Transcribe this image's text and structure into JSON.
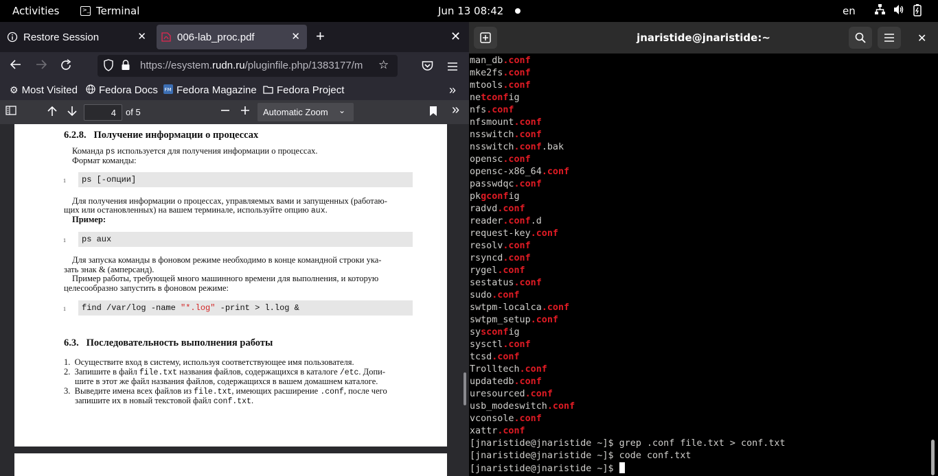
{
  "topbar": {
    "activities": "Activities",
    "app_name": "Terminal",
    "clock": "Jun 13  08:42",
    "lang": "en"
  },
  "firefox": {
    "tabs": [
      {
        "label": "Restore Session",
        "active": false
      },
      {
        "label": "006-lab_proc.pdf",
        "active": true
      }
    ],
    "url": {
      "prefix": "https://esystem.",
      "domain": "rudn.ru",
      "path": "/pluginfile.php/1383177/m"
    },
    "bookmarks": [
      "Most Visited",
      "Fedora Docs",
      "Fedora Magazine",
      "Fedora Project"
    ],
    "pdf_toolbar": {
      "page_number": "4",
      "page_of": "of 5",
      "zoom": "Automatic Zoom"
    }
  },
  "pdf": {
    "section1_num": "6.2.8.",
    "section1_title": "Получение информации о процессах",
    "p1_line1a": "Команда ",
    "p1_line1_code": "ps",
    "p1_line1b": " используется для получения информации о процессах.",
    "p1_line2": "Формат команды:",
    "code1": "ps [-опции]",
    "p2_line1": "Для получения информации о процессах, управляемых вами и запущенных (работаю-",
    "p2_line2a": "щих или остановленных) на вашем терминале, используйте опцию ",
    "p2_line2_code": "aux",
    "p2_line2b": ".",
    "example_label": "Пример:",
    "code2": "ps aux",
    "p3_line1": "Для запуска команды в фоновом режиме необходимо в конце командной строки ука-",
    "p3_line2": "зать знак & (амперсанд).",
    "p3_line3": "Пример работы, требующей много машинного времени для выполнения, и которую",
    "p3_line4": "целесообразно запустить в фоновом режиме:",
    "code3_a": "find /var/log -name ",
    "code3_str": "\"*.log\"",
    "code3_b": " -print > l.log &",
    "line_marker": "1",
    "section2_num": "6.3.",
    "section2_title": "Последовательность выполнения работы",
    "steps": [
      {
        "n": "1.",
        "l1a": "Осуществите вход в систему, используя соответствующее имя пользователя."
      },
      {
        "n": "2.",
        "l1a": "Запишите в файл ",
        "l1code": "file.txt",
        "l1b": " названия файлов, содержащихся в каталоге ",
        "l1code2": "/etc",
        "l1c": ". Допи-",
        "l2": "шите в этот же файл названия файлов, содержащихся в вашем домашнем каталоге."
      },
      {
        "n": "3.",
        "l1a": "Выведите имена всех файлов из ",
        "l1code": "file.txt",
        "l1b": ", имеющих расширение ",
        "l1code2": ".conf",
        "l1c": ", после чего",
        "l2a": "запишите их в новый текстовой файл ",
        "l2code": "conf.txt",
        "l2b": "."
      }
    ]
  },
  "terminal": {
    "title": "jnaristide@jnaristide:~",
    "lines": [
      [
        [
          "man_db",
          ""
        ],
        [
          ".conf",
          "r"
        ]
      ],
      [
        [
          "mke2fs",
          ""
        ],
        [
          ".conf",
          "r"
        ]
      ],
      [
        [
          "mtools",
          ""
        ],
        [
          ".conf",
          "r"
        ]
      ],
      [
        [
          "ne",
          ""
        ],
        [
          "tconf",
          "r"
        ],
        [
          "ig",
          ""
        ]
      ],
      [
        [
          "nfs",
          ""
        ],
        [
          ".conf",
          "r"
        ]
      ],
      [
        [
          "nfsmount",
          ""
        ],
        [
          ".conf",
          "r"
        ]
      ],
      [
        [
          "nsswitch",
          ""
        ],
        [
          ".conf",
          "r"
        ]
      ],
      [
        [
          "nsswitch",
          ""
        ],
        [
          ".conf",
          "r"
        ],
        [
          ".bak",
          ""
        ]
      ],
      [
        [
          "opensc",
          ""
        ],
        [
          ".conf",
          "r"
        ]
      ],
      [
        [
          "opensc-x86_64",
          ""
        ],
        [
          ".conf",
          "r"
        ]
      ],
      [
        [
          "passwdqc",
          ""
        ],
        [
          ".conf",
          "r"
        ]
      ],
      [
        [
          "pk",
          ""
        ],
        [
          "gconf",
          "r"
        ],
        [
          "ig",
          ""
        ]
      ],
      [
        [
          "radvd",
          ""
        ],
        [
          ".conf",
          "r"
        ]
      ],
      [
        [
          "reader",
          ""
        ],
        [
          ".conf",
          "r"
        ],
        [
          ".d",
          ""
        ]
      ],
      [
        [
          "request-key",
          ""
        ],
        [
          ".conf",
          "r"
        ]
      ],
      [
        [
          "resolv",
          ""
        ],
        [
          ".conf",
          "r"
        ]
      ],
      [
        [
          "rsyncd",
          ""
        ],
        [
          ".conf",
          "r"
        ]
      ],
      [
        [
          "rygel",
          ""
        ],
        [
          ".conf",
          "r"
        ]
      ],
      [
        [
          "sestatus",
          ""
        ],
        [
          ".conf",
          "r"
        ]
      ],
      [
        [
          "sudo",
          ""
        ],
        [
          ".conf",
          "r"
        ]
      ],
      [
        [
          "swtpm-localca",
          ""
        ],
        [
          ".conf",
          "r"
        ]
      ],
      [
        [
          "swtpm_setup",
          ""
        ],
        [
          ".conf",
          "r"
        ]
      ],
      [
        [
          "sy",
          ""
        ],
        [
          "sconf",
          "r"
        ],
        [
          "ig",
          ""
        ]
      ],
      [
        [
          "sysctl",
          ""
        ],
        [
          ".conf",
          "r"
        ]
      ],
      [
        [
          "tcsd",
          ""
        ],
        [
          ".conf",
          "r"
        ]
      ],
      [
        [
          "Trolltech",
          ""
        ],
        [
          ".conf",
          "r"
        ]
      ],
      [
        [
          "updatedb",
          ""
        ],
        [
          ".conf",
          "r"
        ]
      ],
      [
        [
          "uresourced",
          ""
        ],
        [
          ".conf",
          "r"
        ]
      ],
      [
        [
          "usb_modeswitch",
          ""
        ],
        [
          ".conf",
          "r"
        ]
      ],
      [
        [
          "vconsole",
          ""
        ],
        [
          ".conf",
          "r"
        ]
      ],
      [
        [
          "xattr",
          ""
        ],
        [
          ".conf",
          "r"
        ]
      ],
      [
        [
          "[jnaristide@jnaristide ~]$ grep .conf file.txt > conf.txt",
          ""
        ]
      ],
      [
        [
          "[jnaristide@jnaristide ~]$ code conf.txt",
          ""
        ]
      ],
      [
        [
          "[jnaristide@jnaristide ~]$ ",
          ""
        ]
      ]
    ]
  }
}
